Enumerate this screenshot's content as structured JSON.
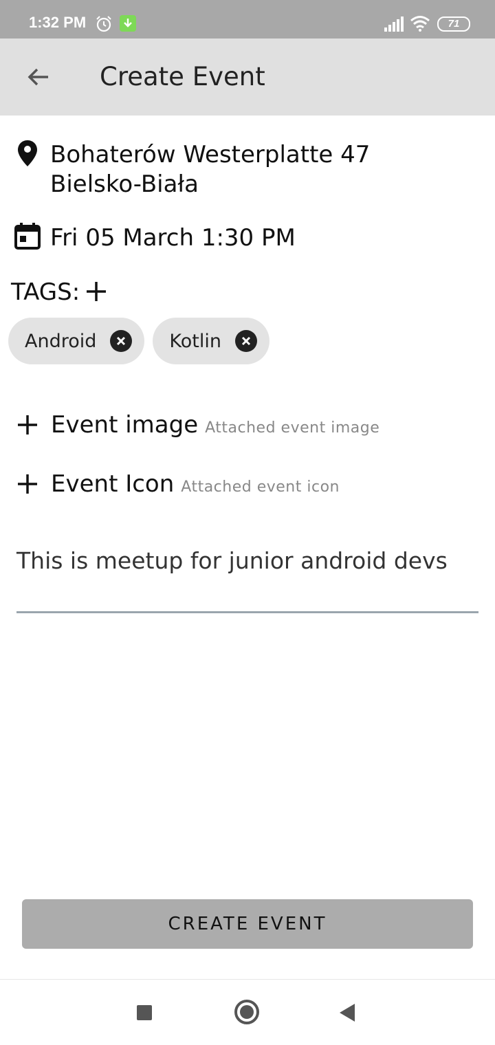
{
  "status_bar": {
    "time": "1:32 PM",
    "battery": "71",
    "icons": [
      "alarm-icon",
      "download-icon",
      "signal-icon",
      "wifi-icon",
      "battery-icon"
    ]
  },
  "app_bar": {
    "title": "Create Event",
    "back_icon": "arrow-back-icon"
  },
  "location": {
    "icon": "location-pin-icon",
    "line1": "Bohaterów Westerplatte 47",
    "line2": "Bielsko-Biała"
  },
  "date": {
    "icon": "calendar-icon",
    "text": "Fri 05 March 1:30 PM"
  },
  "tags": {
    "label": "TAGS:",
    "add_icon": "plus-icon",
    "items": [
      {
        "label": "Android"
      },
      {
        "label": "Kotlin"
      }
    ]
  },
  "attachments": {
    "image": {
      "title": "Event image",
      "subtitle": "Attached event image"
    },
    "icon": {
      "title": "Event Icon",
      "subtitle": "Attached event icon"
    }
  },
  "description": {
    "value": "This is meetup for junior android devs"
  },
  "create_button": {
    "label": "CREATE EVENT"
  },
  "colors": {
    "status_bar": "#a8a8a8",
    "app_bar": "#e0e0e0",
    "chip": "#e3e3e3",
    "button": "#acacac",
    "underline": "#9aa5ad"
  }
}
